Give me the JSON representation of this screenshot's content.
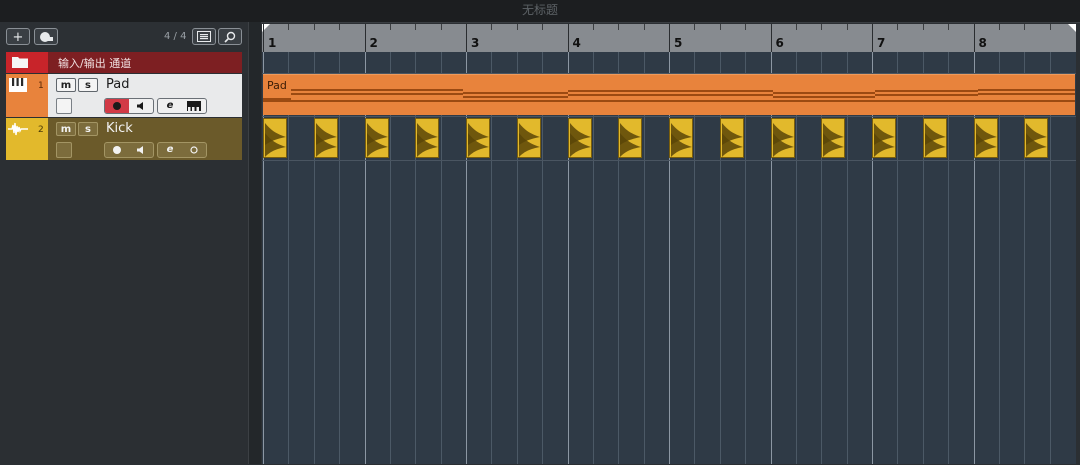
{
  "window": {
    "title": "无标题"
  },
  "toolbar": {
    "add_icon": "plus-icon",
    "add_track_label": "+",
    "folder_tool_icon": "folder-add-icon",
    "counter": "4 / 4",
    "list_icon": "list-icon",
    "search_icon": "search-icon"
  },
  "tracks": {
    "folder": {
      "name": "输入/输出 通道",
      "icon": "folder-icon",
      "color": "#c8242a"
    },
    "pad": {
      "number": "1",
      "name": "Pad",
      "icon": "keyboard-icon",
      "color": "#e8833c",
      "mute": "m",
      "solo": "s",
      "record_icon": "record-icon",
      "monitor_icon": "speaker-icon",
      "edit_label": "e",
      "instrument_icon": "piano-keys-icon"
    },
    "kick": {
      "number": "2",
      "name": "Kick",
      "icon": "waveform-icon",
      "color": "#e2b92c",
      "mute": "m",
      "solo": "s",
      "record_icon": "record-icon",
      "monitor_icon": "speaker-icon",
      "edit_label": "e",
      "extra_icon": "circle-icon"
    }
  },
  "ruler": {
    "bars": [
      "1",
      "2",
      "3",
      "4",
      "5",
      "6",
      "7",
      "8"
    ]
  },
  "events": {
    "pad_label": "Pad",
    "kick_hits": 16
  },
  "colors": {
    "pad_event": "#e8833c",
    "kick_event": "#e2b92c",
    "arrange_bg": "#2f3a46",
    "folder": "#7d1f22"
  }
}
